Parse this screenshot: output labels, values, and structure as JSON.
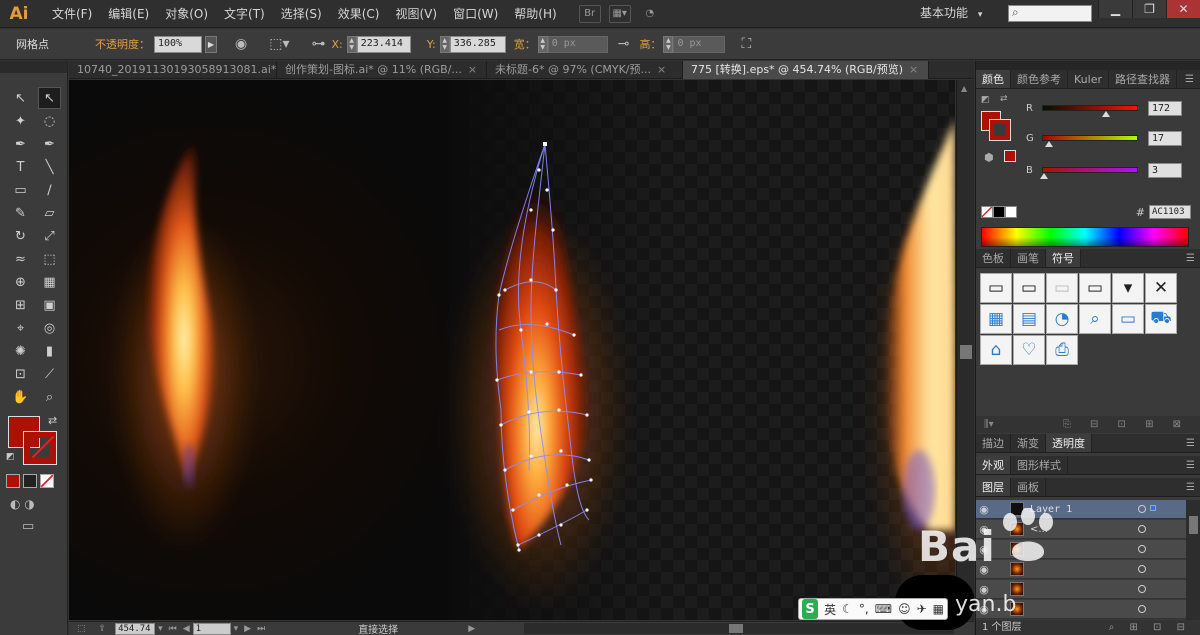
{
  "app": {
    "logo": "Ai",
    "menus": [
      "文件(F)",
      "编辑(E)",
      "对象(O)",
      "文字(T)",
      "选择(S)",
      "效果(C)",
      "视图(V)",
      "窗口(W)",
      "帮助(H)"
    ],
    "bridge_label": "Br",
    "workspace": "基本功能",
    "workspace_arrow": "▾",
    "window_buttons": [
      "▁",
      "❐",
      "✕"
    ]
  },
  "control_bar": {
    "tool_name": "网格点",
    "opacity_label": "不透明度：",
    "opacity_value": "100%",
    "x_label": "X:",
    "x_value": "223.414",
    "y_label": "Y:",
    "y_value": "336.285",
    "w_label": "宽：",
    "w_value": "0 px",
    "h_label": "高：",
    "h_value": "0 px"
  },
  "tabs": [
    {
      "label": "10740_20191130193058913081.ai*",
      "close": "×"
    },
    {
      "label": "创作策划-图标.ai* @ 11% (RGB/...",
      "close": "×"
    },
    {
      "label": "未标题-6* @ 97% (CMYK/预...",
      "close": "×"
    },
    {
      "label": "775 [转换].eps* @ 454.74% (RGB/预览)",
      "close": "×"
    }
  ],
  "tools": [
    {
      "icon": "selection-tool-icon",
      "glyph": "↖"
    },
    {
      "icon": "direct-selection-tool-icon",
      "glyph": "↖"
    },
    {
      "icon": "magic-wand-tool-icon",
      "glyph": "✦"
    },
    {
      "icon": "lasso-tool-icon",
      "glyph": "◌"
    },
    {
      "icon": "pen-tool-icon",
      "glyph": "✒"
    },
    {
      "icon": "curvature-tool-icon",
      "glyph": "✒"
    },
    {
      "icon": "type-tool-icon",
      "glyph": "T"
    },
    {
      "icon": "line-tool-icon",
      "glyph": "╲"
    },
    {
      "icon": "rectangle-tool-icon",
      "glyph": "▭"
    },
    {
      "icon": "paintbrush-tool-icon",
      "glyph": "∕"
    },
    {
      "icon": "pencil-tool-icon",
      "glyph": "✎"
    },
    {
      "icon": "eraser-tool-icon",
      "glyph": "▱"
    },
    {
      "icon": "rotate-tool-icon",
      "glyph": "↻"
    },
    {
      "icon": "scale-tool-icon",
      "glyph": "⤢"
    },
    {
      "icon": "warp-tool-icon",
      "glyph": "≈"
    },
    {
      "icon": "free-transform-tool-icon",
      "glyph": "⬚"
    },
    {
      "icon": "shape-builder-tool-icon",
      "glyph": "⊕"
    },
    {
      "icon": "perspective-grid-tool-icon",
      "glyph": "▦"
    },
    {
      "icon": "mesh-tool-icon",
      "glyph": "⊞"
    },
    {
      "icon": "gradient-tool-icon",
      "glyph": "▣"
    },
    {
      "icon": "eyedropper-tool-icon",
      "glyph": "⌖"
    },
    {
      "icon": "blend-tool-icon",
      "glyph": "◎"
    },
    {
      "icon": "symbol-sprayer-tool-icon",
      "glyph": "✺"
    },
    {
      "icon": "column-graph-tool-icon",
      "glyph": "▮"
    },
    {
      "icon": "artboard-tool-icon",
      "glyph": "⊡"
    },
    {
      "icon": "slice-tool-icon",
      "glyph": "⟋"
    },
    {
      "icon": "hand-tool-icon",
      "glyph": "✋"
    },
    {
      "icon": "zoom-tool-icon",
      "glyph": "⌕"
    }
  ],
  "color_panel": {
    "tabs": [
      "颜色",
      "颜色参考",
      "Kuler",
      "路径查找器"
    ],
    "channels": [
      {
        "label": "R",
        "value": "172",
        "fraction": 0.674
      },
      {
        "label": "G",
        "value": "17",
        "fraction": 0.067
      },
      {
        "label": "B",
        "value": "3",
        "fraction": 0.012
      }
    ],
    "hex_label": "#",
    "hex": "AC1103",
    "fill_color": "#ac1103"
  },
  "symbol_panel": {
    "tabs": [
      "色板",
      "画笔",
      "符号"
    ]
  },
  "lower_tabs": {
    "row1": [
      "描边",
      "渐变",
      "透明度"
    ],
    "row2": [
      "外观",
      "图形样式"
    ],
    "row3": [
      "图层",
      "画板"
    ]
  },
  "layers": {
    "items": [
      {
        "name": "Layer 1"
      },
      {
        "name": "<..."
      }
    ],
    "count": "1 个图层"
  },
  "status": {
    "zoom": "454.74",
    "artboard": "1",
    "tool": "直接选择"
  },
  "ime": {
    "logo": "S",
    "mode": "英"
  },
  "watermark": {
    "text": "Bai",
    "sub": "yan.b"
  }
}
